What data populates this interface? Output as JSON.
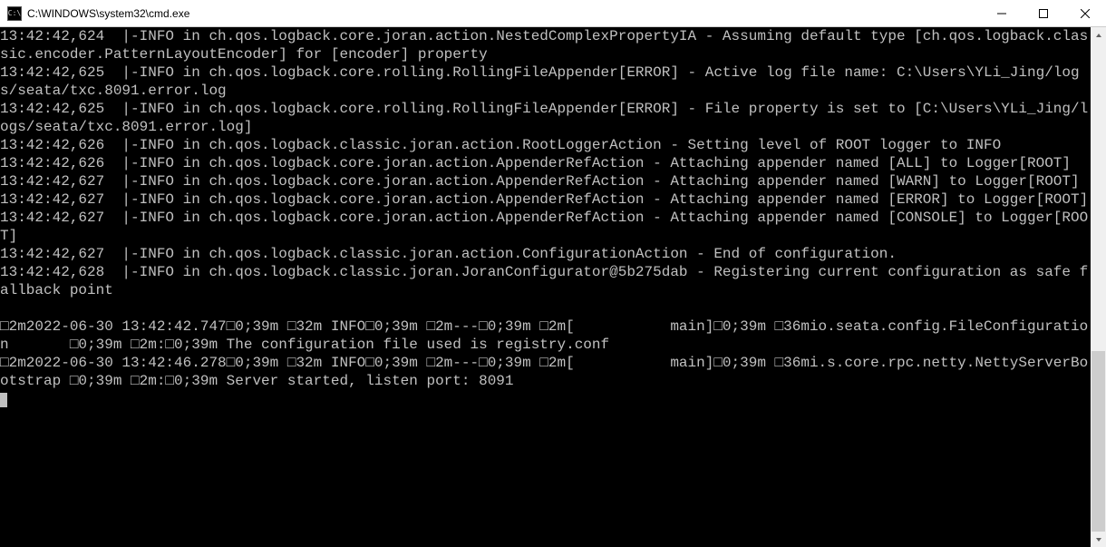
{
  "window": {
    "title": "C:\\WINDOWS\\system32\\cmd.exe",
    "icon_label": "C:\\"
  },
  "terminal": {
    "lines": [
      "13:42:42,624  |-INFO in ch.qos.logback.core.joran.action.NestedComplexPropertyIA - Assuming default type [ch.qos.logback.classic.encoder.PatternLayoutEncoder] for [encoder] property",
      "13:42:42,625  |-INFO in ch.qos.logback.core.rolling.RollingFileAppender[ERROR] - Active log file name: C:\\Users\\YLi_Jing/logs/seata/txc.8091.error.log",
      "13:42:42,625  |-INFO in ch.qos.logback.core.rolling.RollingFileAppender[ERROR] - File property is set to [C:\\Users\\YLi_Jing/logs/seata/txc.8091.error.log]",
      "13:42:42,626  |-INFO in ch.qos.logback.classic.joran.action.RootLoggerAction - Setting level of ROOT logger to INFO",
      "13:42:42,626  |-INFO in ch.qos.logback.core.joran.action.AppenderRefAction - Attaching appender named [ALL] to Logger[ROOT]",
      "13:42:42,627  |-INFO in ch.qos.logback.core.joran.action.AppenderRefAction - Attaching appender named [WARN] to Logger[ROOT]",
      "13:42:42,627  |-INFO in ch.qos.logback.core.joran.action.AppenderRefAction - Attaching appender named [ERROR] to Logger[ROOT]",
      "13:42:42,627  |-INFO in ch.qos.logback.core.joran.action.AppenderRefAction - Attaching appender named [CONSOLE] to Logger[ROOT]",
      "13:42:42,627  |-INFO in ch.qos.logback.classic.joran.action.ConfigurationAction - End of configuration.",
      "13:42:42,628  |-INFO in ch.qos.logback.classic.joran.JoranConfigurator@5b275dab - Registering current configuration as safe fallback point",
      "",
      "□2m2022-06-30 13:42:42.747□0;39m □32m INFO□0;39m □2m---□0;39m □2m[           main]□0;39m □36mio.seata.config.FileConfiguration       □0;39m □2m:□0;39m The configuration file used is registry.conf",
      "□2m2022-06-30 13:42:46.278□0;39m □32m INFO□0;39m □2m---□0;39m □2m[           main]□0;39m □36mi.s.core.rpc.netty.NettyServerBootstrap □0;39m □2m:□0;39m Server started, listen port: 8091"
    ]
  }
}
